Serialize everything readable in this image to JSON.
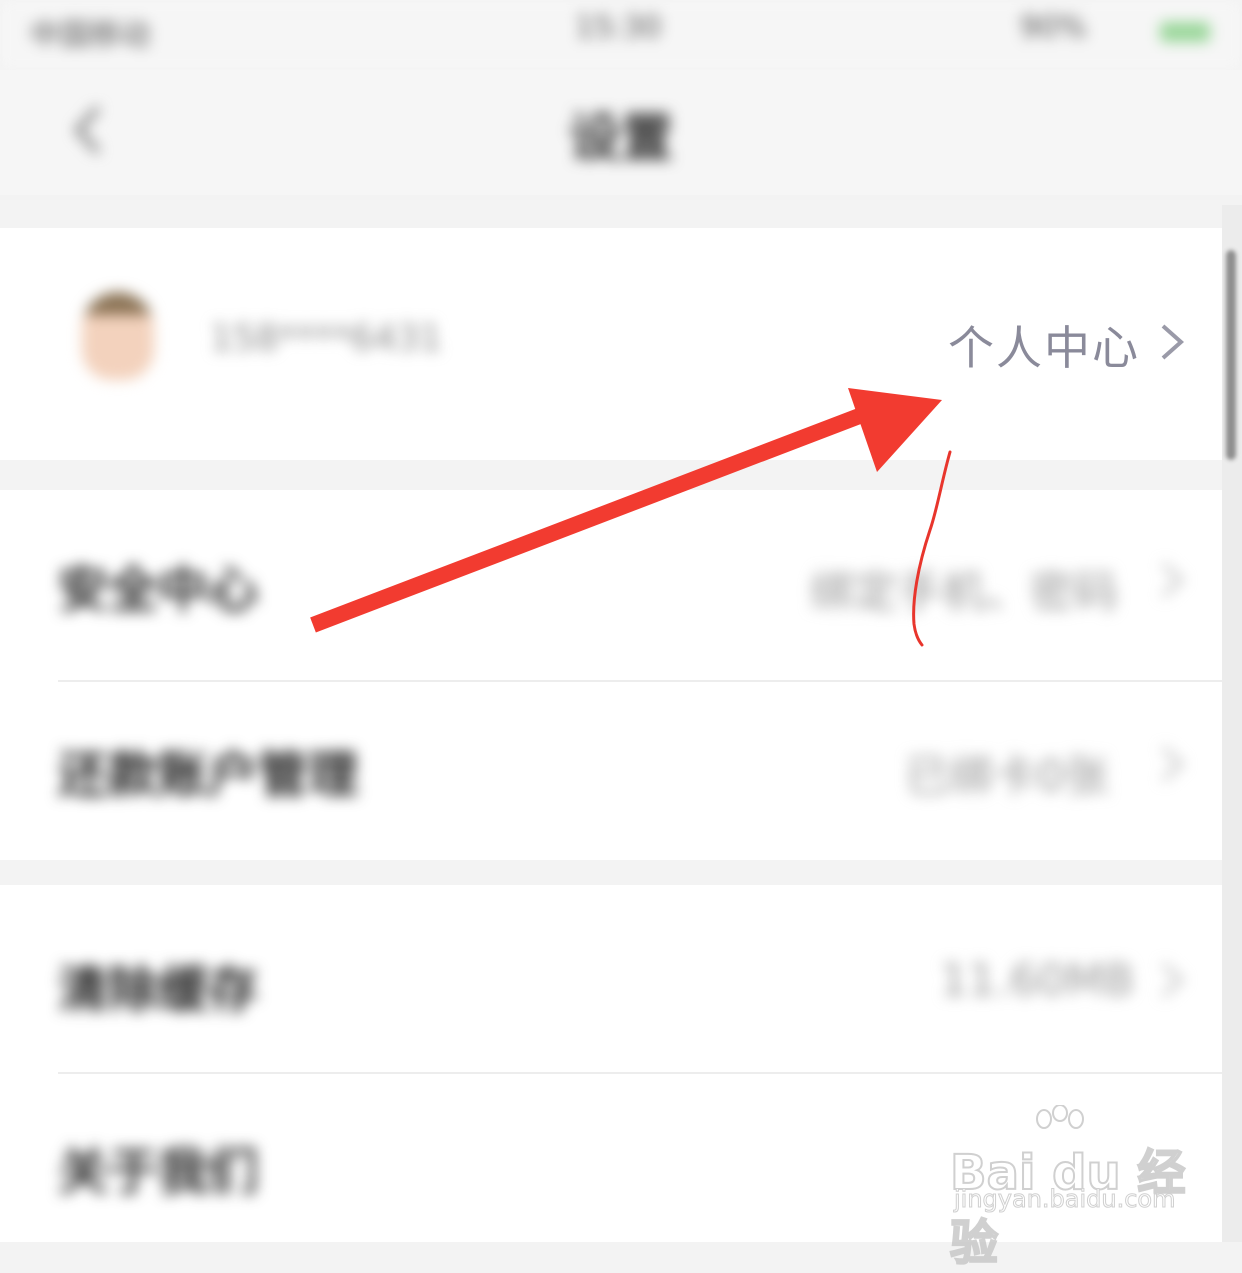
{
  "status_bar": {
    "carrier": "中国移动",
    "time": "15:30",
    "battery": "90%",
    "battery_color": "#9ad79a"
  },
  "nav": {
    "back_icon": "chevron-left-icon",
    "title": "设置"
  },
  "profile": {
    "username": "158****6431",
    "link_label": "个人中心",
    "link_icon": "chevron-right-icon"
  },
  "rows": [
    {
      "label": "安全中心",
      "value": "绑定手机、密码"
    },
    {
      "label": "还款账户管理",
      "value": "已绑卡0张"
    },
    {
      "label": "清除缓存",
      "value": "11.60MB"
    },
    {
      "label": "关于我们",
      "value": ""
    }
  ],
  "annotation": {
    "arrow_color": "#f23b30",
    "stroke_color": "#e8352c"
  },
  "watermark": {
    "brand": "Bai du 经验",
    "url": "jingyan.baidu.com"
  }
}
